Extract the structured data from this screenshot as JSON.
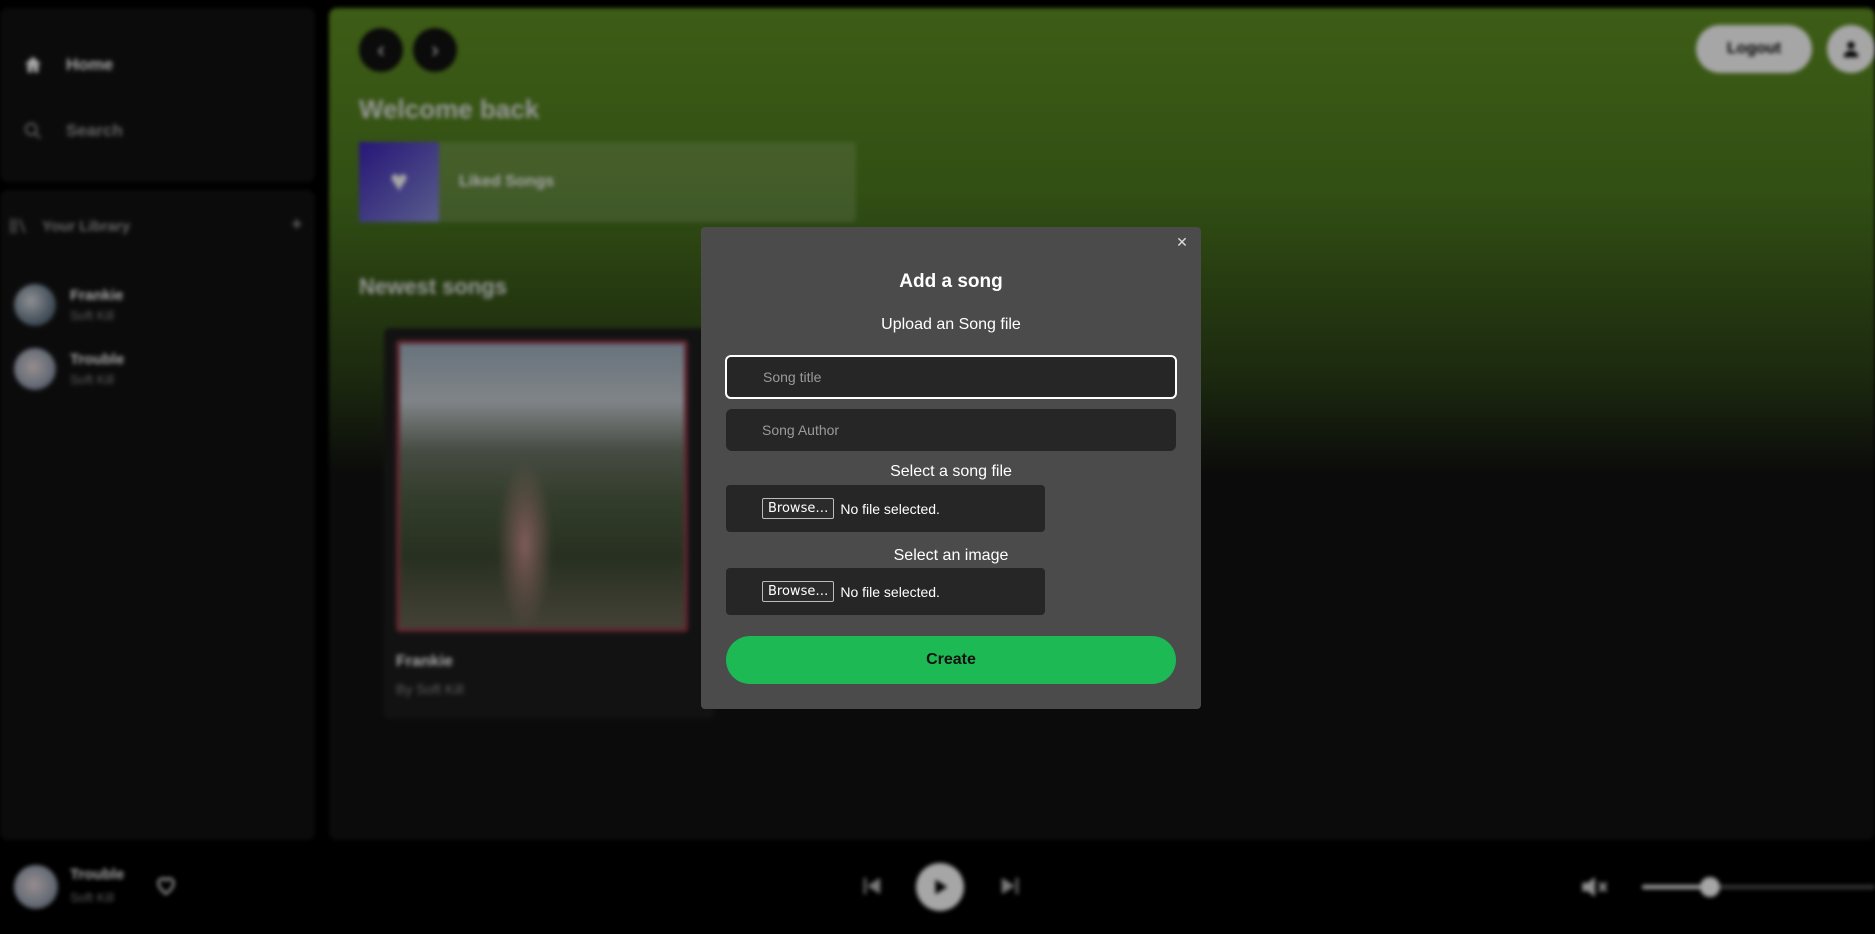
{
  "sidebar": {
    "home_label": "Home",
    "search_label": "Search",
    "library_label": "Your Library",
    "library_add": "+",
    "library_items": [
      {
        "title": "Frankie",
        "author": "Soft Kill"
      },
      {
        "title": "Trouble",
        "author": "Soft Kill"
      }
    ]
  },
  "header": {
    "back_icon": "‹",
    "forward_icon": "›",
    "logout_label": "Logout"
  },
  "main": {
    "welcome": "Welcome back",
    "liked_songs": "Liked Songs",
    "newest_title": "Newest songs",
    "song_card": {
      "title": "Frankie",
      "subtitle": "By Soft Kill"
    }
  },
  "player": {
    "title": "Trouble",
    "author": "Soft Kill",
    "volume_level": 0.29
  },
  "modal": {
    "close": "✕",
    "title": "Add a song",
    "description": "Upload an Song file",
    "title_placeholder": "Song title",
    "author_placeholder": "Song Author",
    "song_file_label": "Select a song file",
    "image_label": "Select an image",
    "browse_label": "Browse…",
    "no_file": "No file selected.",
    "create_label": "Create",
    "accent_color": "#1db954"
  }
}
